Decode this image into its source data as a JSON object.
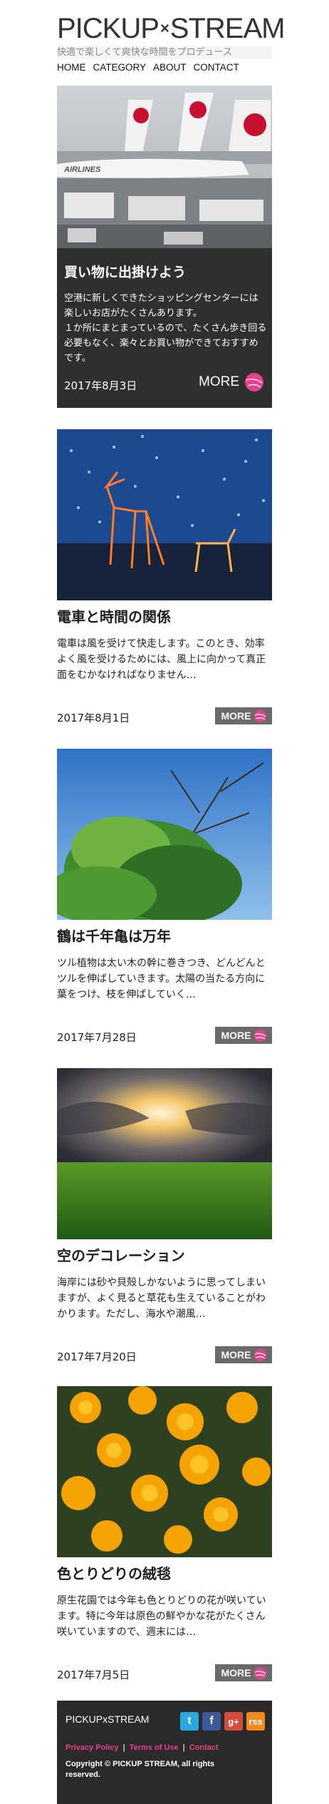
{
  "header": {
    "logo_left": "PICKUP",
    "logo_cross": "×",
    "logo_right": "STREAM",
    "tagline": "快適で楽しくて爽快な時間をプロデュース",
    "nav": [
      "HOME",
      "CATEGORY",
      "ABOUT",
      "CONTACT"
    ]
  },
  "feature": {
    "title": "買い物に出掛けよう",
    "text": "空港に新しくできたショッピングセンターには楽しいお店がたくさんあります。\n１か所にまとまっているので、たくさん歩き回る必要もなく、楽々とお買い物ができておすすめです。",
    "date": "2017年8月3日",
    "more": "MORE",
    "image_text": "AIRLINES"
  },
  "posts": [
    {
      "title": "電車と時間の関係",
      "text": "電車は風を受けて快走します。このとき、効率よく風を受けるためには、風上に向かって真正面をむかなければなりません…",
      "date": "2017年8月1日",
      "more": "MORE"
    },
    {
      "title": "鶴は千年亀は万年",
      "text": "ツル植物は太い木の幹に巻きつき、どんどんとツルを伸ばしていきます。太陽の当たる方向に葉をつけ、枝を伸ばしていく…",
      "date": "2017年7月28日",
      "more": "MORE"
    },
    {
      "title": "空のデコレーション",
      "text": "海岸には砂や貝殻しかないように思ってしまいますが、よく見ると草花も生えていることがわかります。ただし、海水や潮風…",
      "date": "2017年7月20日",
      "more": "MORE"
    },
    {
      "title": "色とりどりの絨毯",
      "text": "原生花園では今年も色とりどりの花が咲いています。特に今年は原色の鮮やかな花がたくさん咲いていますので、週末には…",
      "date": "2017年7月5日",
      "more": "MORE"
    }
  ],
  "footer": {
    "logo": "PICKUPxSTREAM",
    "social": [
      {
        "icon": "twitter-icon",
        "glyph": "t"
      },
      {
        "icon": "facebook-icon",
        "glyph": "f"
      },
      {
        "icon": "google-plus-icon",
        "glyph": "g+"
      },
      {
        "icon": "rss-icon",
        "glyph": "rss"
      }
    ],
    "privacy": "Privacy Policy",
    "terms": "Terms of Use",
    "contact": "Contact",
    "copyright": "Copyright © PICKUP STREAM, all rights reserved."
  },
  "colors": {
    "accent": "#e8408c",
    "feature_bg": "#2f2f2f",
    "footer_bg": "#2a2a2a",
    "more_button_bg": "#6a6a6a"
  }
}
